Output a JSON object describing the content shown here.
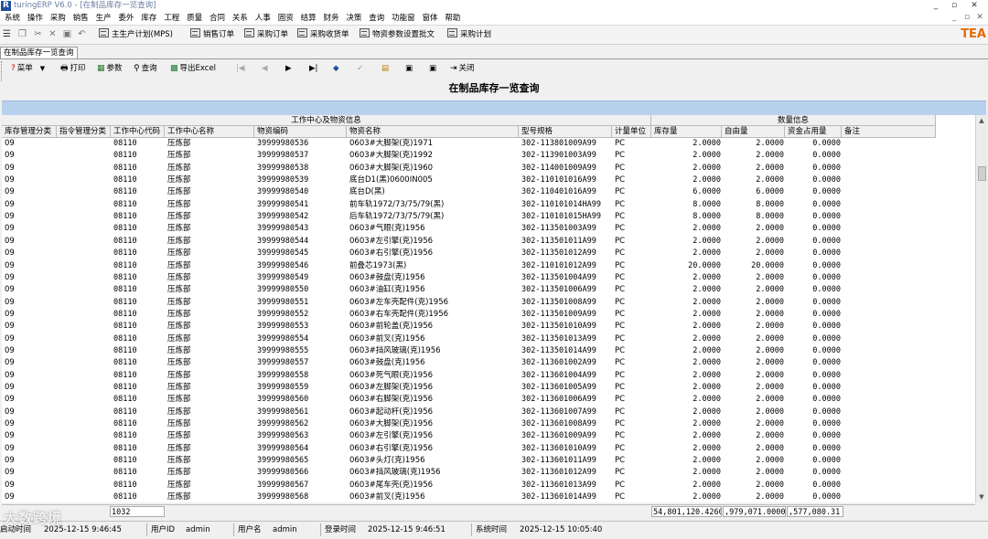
{
  "window": {
    "title": "turingERP V6.0 - [在制品库存一览查询]",
    "app_letter": "R",
    "controls": [
      "_",
      "▫",
      "✕"
    ],
    "mdi_controls": [
      "_",
      "▫",
      "✕"
    ]
  },
  "menu": [
    "系统",
    "操作",
    "采购",
    "销售",
    "生产",
    "委外",
    "库存",
    "工程",
    "质量",
    "合同",
    "关系",
    "人事",
    "固资",
    "结算",
    "财务",
    "决策",
    "查询",
    "功能窗",
    "窗体",
    "帮助"
  ],
  "quickbar": {
    "buttons": [
      "主生产计划(MPS)",
      "销售订单",
      "采购订单",
      "采购收货单",
      "物资参数设置批文",
      "采购计划"
    ],
    "brand": "TEA"
  },
  "doc_tab": "在制品库存一览查询",
  "form_toolbar": {
    "menu": "菜单",
    "print": "打印",
    "params": "参数",
    "query": "查询",
    "export": "导出Excel",
    "close": "关闭",
    "nav": [
      "|◀",
      "◀",
      "▶",
      "▶|"
    ]
  },
  "form_title": "在制品库存一览查询",
  "grid": {
    "group_headers": {
      "left": "工作中心及物资信息",
      "right": "数量信息"
    },
    "columns": [
      "库存管理分类",
      "指令管理分类",
      "工作中心代码",
      "工作中心名称",
      "物资编码",
      "物资名称",
      "型号规格",
      "计量单位",
      "库存量",
      "自由量",
      "资金占用量",
      "备注"
    ],
    "rows": [
      [
        "09",
        "",
        "08110",
        "压炼部",
        "39999980536",
        "0603#大脚架(克)1971",
        "302-113801009A99",
        "PC",
        "2.0000",
        "2.0000",
        "0.0000",
        ""
      ],
      [
        "09",
        "",
        "08110",
        "压炼部",
        "39999980537",
        "0603#大脚架(克)1992",
        "302-113901003A99",
        "PC",
        "2.0000",
        "2.0000",
        "0.0000",
        ""
      ],
      [
        "09",
        "",
        "08110",
        "压炼部",
        "39999980538",
        "0603#大脚架(克)1960",
        "302-114001009A99",
        "PC",
        "2.0000",
        "2.0000",
        "0.0000",
        ""
      ],
      [
        "09",
        "",
        "08110",
        "压炼部",
        "39999980539",
        "底台D1(黑)0600IN005",
        "302-110101016A99",
        "PC",
        "2.0000",
        "2.0000",
        "0.0000",
        ""
      ],
      [
        "09",
        "",
        "08110",
        "压炼部",
        "39999980540",
        "底台D(黑)",
        "302-110401016A99",
        "PC",
        "6.0000",
        "6.0000",
        "0.0000",
        ""
      ],
      [
        "09",
        "",
        "08110",
        "压炼部",
        "39999980541",
        "前车轨1972/73/75/79(黑)",
        "302-110101014HA99",
        "PC",
        "8.0000",
        "8.0000",
        "0.0000",
        ""
      ],
      [
        "09",
        "",
        "08110",
        "压炼部",
        "39999980542",
        "后车轨1972/73/75/79(黑)",
        "302-110101015HA99",
        "PC",
        "8.0000",
        "8.0000",
        "0.0000",
        ""
      ],
      [
        "09",
        "",
        "08110",
        "压炼部",
        "39999980543",
        "0603#气眼(克)1956",
        "302-113501003A99",
        "PC",
        "2.0000",
        "2.0000",
        "0.0000",
        ""
      ],
      [
        "09",
        "",
        "08110",
        "压炼部",
        "39999980544",
        "0603#左引擎(克)1956",
        "302-113501011A99",
        "PC",
        "2.0000",
        "2.0000",
        "0.0000",
        ""
      ],
      [
        "09",
        "",
        "08110",
        "压炼部",
        "39999980545",
        "0603#右引擎(克)1956",
        "302-113501012A99",
        "PC",
        "2.0000",
        "2.0000",
        "0.0000",
        ""
      ],
      [
        "09",
        "",
        "08110",
        "压炼部",
        "39999980546",
        "前叠芯1973(黑)",
        "302-110101012A99",
        "PC",
        "20.0000",
        "20.0000",
        "0.0000",
        ""
      ],
      [
        "09",
        "",
        "08110",
        "压炼部",
        "39999980549",
        "0603#鼓盘(克)1956",
        "302-113501004A99",
        "PC",
        "2.0000",
        "2.0000",
        "0.0000",
        ""
      ],
      [
        "09",
        "",
        "08110",
        "压炼部",
        "39999980550",
        "0603#油缸(克)1956",
        "302-113501006A99",
        "PC",
        "2.0000",
        "2.0000",
        "0.0000",
        ""
      ],
      [
        "09",
        "",
        "08110",
        "压炼部",
        "39999980551",
        "0603#左车壳配件(克)1956",
        "302-113501008A99",
        "PC",
        "2.0000",
        "2.0000",
        "0.0000",
        ""
      ],
      [
        "09",
        "",
        "08110",
        "压炼部",
        "39999980552",
        "0603#右车壳配件(克)1956",
        "302-113501009A99",
        "PC",
        "2.0000",
        "2.0000",
        "0.0000",
        ""
      ],
      [
        "09",
        "",
        "08110",
        "压炼部",
        "39999980553",
        "0603#前轮盖(克)1956",
        "302-113501010A99",
        "PC",
        "2.0000",
        "2.0000",
        "0.0000",
        ""
      ],
      [
        "09",
        "",
        "08110",
        "压炼部",
        "39999980554",
        "0603#前叉(克)1956",
        "302-113501013A99",
        "PC",
        "2.0000",
        "2.0000",
        "0.0000",
        ""
      ],
      [
        "09",
        "",
        "08110",
        "压炼部",
        "39999980555",
        "0603#挡风玻璃(克)1956",
        "302-113501014A99",
        "PC",
        "2.0000",
        "2.0000",
        "0.0000",
        ""
      ],
      [
        "09",
        "",
        "08110",
        "压炼部",
        "39999980557",
        "0603#鼓盘(克)1956",
        "302-113601002A99",
        "PC",
        "2.0000",
        "2.0000",
        "0.0000",
        ""
      ],
      [
        "09",
        "",
        "08110",
        "压炼部",
        "39999980558",
        "0603#死气眼(克)1956",
        "302-113601004A99",
        "PC",
        "2.0000",
        "2.0000",
        "0.0000",
        ""
      ],
      [
        "09",
        "",
        "08110",
        "压炼部",
        "39999980559",
        "0603#左脚架(克)1956",
        "302-113601005A99",
        "PC",
        "2.0000",
        "2.0000",
        "0.0000",
        ""
      ],
      [
        "09",
        "",
        "08110",
        "压炼部",
        "39999980560",
        "0603#右脚架(克)1956",
        "302-113601006A99",
        "PC",
        "2.0000",
        "2.0000",
        "0.0000",
        ""
      ],
      [
        "09",
        "",
        "08110",
        "压炼部",
        "39999980561",
        "0603#起动杆(克)1956",
        "302-113601007A99",
        "PC",
        "2.0000",
        "2.0000",
        "0.0000",
        ""
      ],
      [
        "09",
        "",
        "08110",
        "压炼部",
        "39999980562",
        "0603#大脚架(克)1956",
        "302-113601008A99",
        "PC",
        "2.0000",
        "2.0000",
        "0.0000",
        ""
      ],
      [
        "09",
        "",
        "08110",
        "压炼部",
        "39999980563",
        "0603#左引擎(克)1956",
        "302-113601009A99",
        "PC",
        "2.0000",
        "2.0000",
        "0.0000",
        ""
      ],
      [
        "09",
        "",
        "08110",
        "压炼部",
        "39999980564",
        "0603#右引擎(克)1956",
        "302-113601010A99",
        "PC",
        "2.0000",
        "2.0000",
        "0.0000",
        ""
      ],
      [
        "09",
        "",
        "08110",
        "压炼部",
        "39999980565",
        "0603#头灯(克)1956",
        "302-113601011A99",
        "PC",
        "2.0000",
        "2.0000",
        "0.0000",
        ""
      ],
      [
        "09",
        "",
        "08110",
        "压炼部",
        "39999980566",
        "0603#挡风玻璃(克)1956",
        "302-113601012A99",
        "PC",
        "2.0000",
        "2.0000",
        "0.0000",
        ""
      ],
      [
        "09",
        "",
        "08110",
        "压炼部",
        "39999980567",
        "0603#尾车壳(克)1956",
        "302-113601013A99",
        "PC",
        "2.0000",
        "2.0000",
        "0.0000",
        ""
      ],
      [
        "09",
        "",
        "08110",
        "压炼部",
        "39999980568",
        "0603#前叉(克)1956",
        "302-113601014A99",
        "PC",
        "2.0000",
        "2.0000",
        "0.0000",
        ""
      ]
    ]
  },
  "footer": {
    "count": "1032",
    "total_stock": "54,801,120.4260",
    "total_free": ",979,071.0000",
    "total_fund": ",577,080.31"
  },
  "status": {
    "login_label": "启动时间",
    "login_time": "2025-12-15 9:46:45",
    "user_id_label": "用户ID",
    "user_id": "admin",
    "user_name_label": "用户名",
    "user_name": "admin",
    "logon_label": "登录时间",
    "logon_time": "2025-12-15 9:46:51",
    "sys_label": "系统时间",
    "sys_time": "2025-12-15 10:05:40"
  },
  "watermark": "大数跨境",
  "colors": {
    "accent_bar": "#b8d2ee",
    "logo": "#1f4e9c",
    "brand": "#e46c0a"
  }
}
